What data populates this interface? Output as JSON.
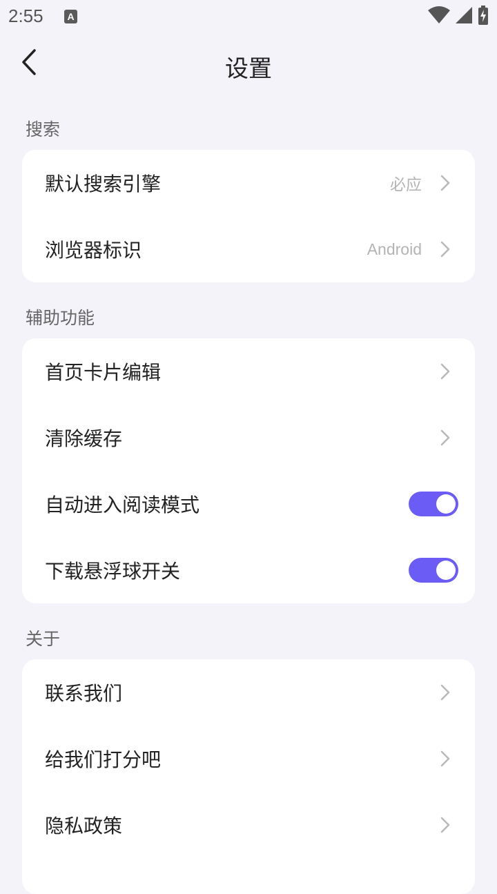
{
  "status": {
    "time": "2:55",
    "notif_letter": "A"
  },
  "header": {
    "title": "设置"
  },
  "sections": {
    "search": {
      "label": "搜索",
      "items": [
        {
          "label": "默认搜索引擎",
          "value": "必应"
        },
        {
          "label": "浏览器标识",
          "value": "Android"
        }
      ]
    },
    "assist": {
      "label": "辅助功能",
      "items": [
        {
          "label": "首页卡片编辑"
        },
        {
          "label": "清除缓存"
        },
        {
          "label": "自动进入阅读模式",
          "toggle": true
        },
        {
          "label": "下载悬浮球开关",
          "toggle": true
        }
      ]
    },
    "about": {
      "label": "关于",
      "items": [
        {
          "label": "联系我们"
        },
        {
          "label": "给我们打分吧"
        },
        {
          "label": "隐私政策"
        }
      ]
    }
  },
  "colors": {
    "background": "#f4f3f9",
    "card": "#ffffff",
    "accent": "#6b5cf6",
    "chevron": "#b8b8b8",
    "value_text": "#b3b3b3"
  },
  "icons": [
    "back-arrow-icon",
    "chevron-right-icon",
    "wifi-icon",
    "signal-icon",
    "battery-charging-icon"
  ]
}
